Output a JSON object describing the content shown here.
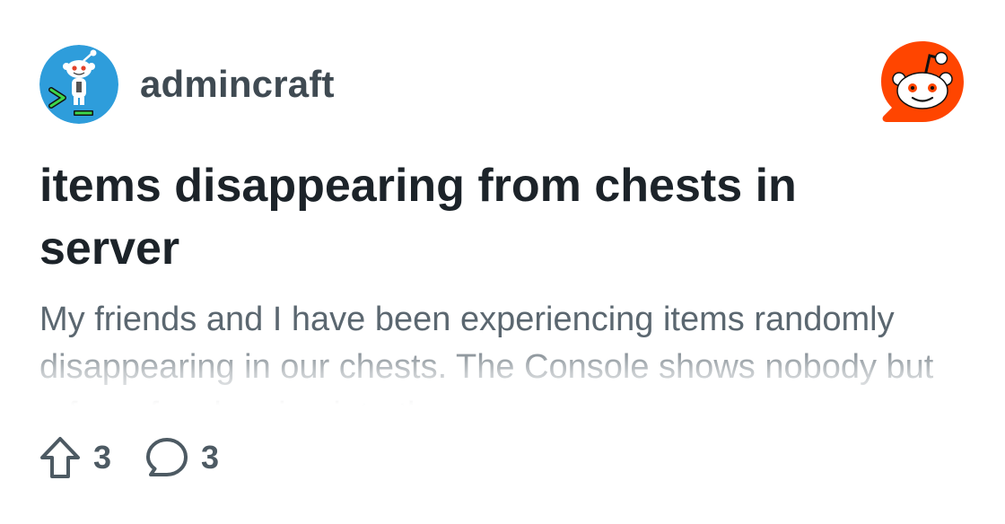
{
  "subreddit": {
    "name": "admincraft",
    "avatar_icon": "snoo-terminal-avatar-icon",
    "avatar_bg": "#2e9ddb"
  },
  "brand": {
    "logo_icon": "reddit-logo-icon",
    "color": "#ff4500"
  },
  "post": {
    "title": "items disappearing from chests in server",
    "body_preview": "My friends and I have been experiencing items randomly disappearing in our chests. The Console shows nobody but a few of us logging into the server"
  },
  "stats": {
    "upvotes": "3",
    "upvote_icon": "upvote-arrow-icon",
    "comments": "3",
    "comment_icon": "comment-bubble-icon"
  },
  "colors": {
    "title": "#1c2329",
    "subreddit_text": "#3f4a52",
    "body_text": "#5b6770",
    "stat_text": "#4d5a63"
  }
}
